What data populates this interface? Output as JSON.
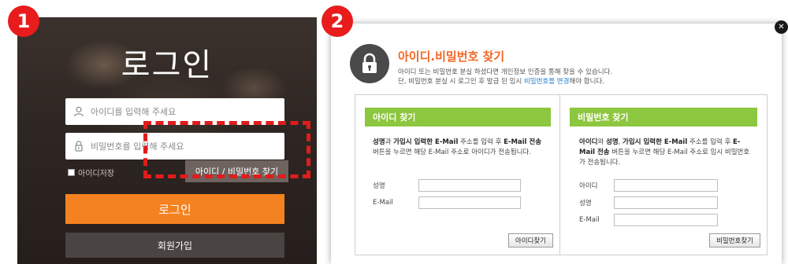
{
  "badges": {
    "step1": "1",
    "step2": "2"
  },
  "login": {
    "title": "로그인",
    "id_placeholder": "아이디를 입력해 주세요",
    "pw_placeholder": "비밀번호를 입력해 주세요",
    "save_id_label": "아이디저장",
    "find_button": "아이디 / 비밀번호 찾기",
    "login_button": "로그인",
    "join_button": "회원가입"
  },
  "popup": {
    "title": "아이디.비밀번호 찾기",
    "desc_line1": "아이디 또는 비밀번호 분실 하셨다면 개인정보 인증을 통해 찾을 수 있습니다.",
    "desc_line2_pre": "단, 비밀번호 분실 시 로그인 후 발급 된 임시 ",
    "desc_line2_link": "비밀번호를 변경",
    "desc_line2_post": "해야 합니다.",
    "find_id": {
      "heading": "아이디 찾기",
      "desc_bold1": "성명",
      "desc_text1": "과 ",
      "desc_bold2": "가입시 입력한 E-Mail",
      "desc_text2": " 주소를 입력 후 ",
      "desc_bold3": "E-Mail 전송",
      "desc_text3": " 버튼을 누르면 해당 E-Mail 주소로 아이디가 전송됩니다.",
      "field_name_label": "성명",
      "field_email_label": "E-Mail",
      "button": "아이디찾기"
    },
    "find_pw": {
      "heading": "비밀번호 찾기",
      "desc_bold1": "아이디",
      "desc_text1": "와 ",
      "desc_bold2": "성명",
      "desc_text2": ", ",
      "desc_bold3": "가입시 입력한 E-Mail",
      "desc_text3": " 주소를 입력 후 ",
      "desc_bold4": "E-Mail 전송",
      "desc_text4": " 버튼을 누르면 해당 E-Mail 주소로 임시 비밀번호가 전송됩니다.",
      "field_id_label": "아이디",
      "field_name_label": "성명",
      "field_email_label": "E-Mail",
      "button": "비밀번호찾기"
    }
  },
  "colors": {
    "badge": "#e81c1c",
    "login_button": "#f58220",
    "popup_title": "#f26522",
    "section_header": "#8dc63f",
    "link": "#1f7fd1"
  },
  "icons": [
    "user-icon",
    "lock-icon",
    "padlock-icon",
    "close-icon"
  ]
}
